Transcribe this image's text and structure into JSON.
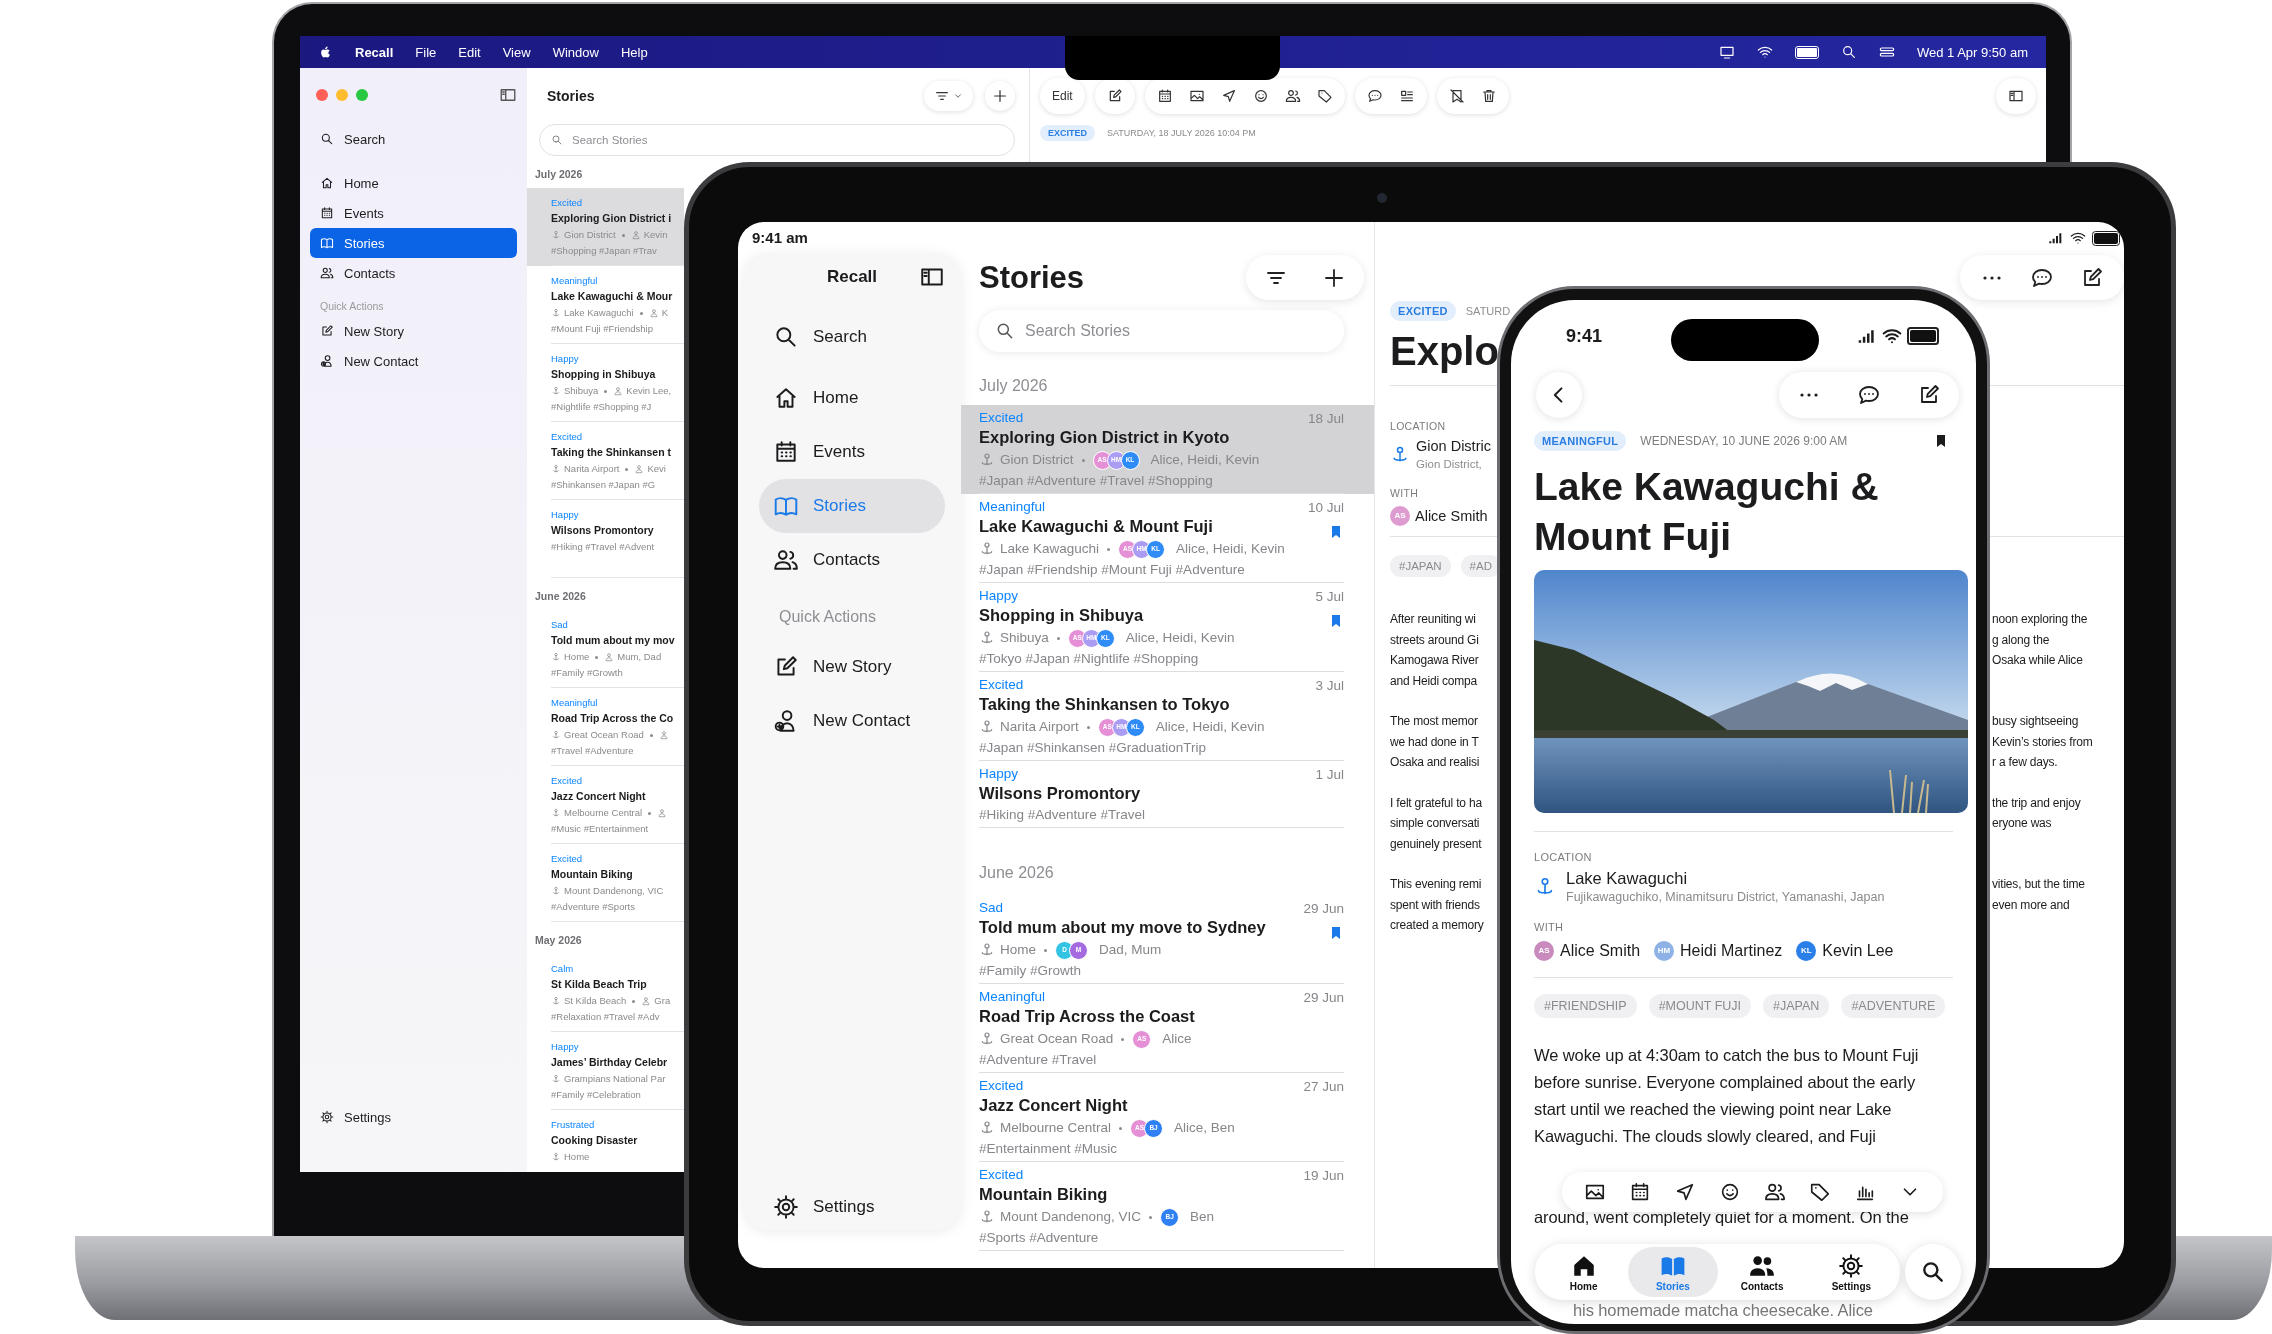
{
  "laptop": {
    "menu_bar": {
      "app": "Recall",
      "menus": [
        "File",
        "Edit",
        "View",
        "Window",
        "Help"
      ],
      "clock": "Wed 1 Apr 9:50 am"
    },
    "sidebar": {
      "search": "Search",
      "items": [
        {
          "label": "Home",
          "selected": false
        },
        {
          "label": "Events",
          "selected": false
        },
        {
          "label": "Stories",
          "selected": true
        },
        {
          "label": "Contacts",
          "selected": false
        }
      ],
      "section": "Quick Actions",
      "actions": [
        "New Story",
        "New Contact"
      ],
      "settings": "Settings"
    },
    "list": {
      "title": "Stories",
      "search_placeholder": "Search Stories",
      "sections": [
        {
          "heading": "July 2026",
          "stories": [
            {
              "mood": "Excited",
              "title": "Exploring Gion District i",
              "place": "Gion District",
              "with_people": true,
              "people": "Kevin",
              "tags": "#Shopping #Japan #Trav",
              "selected": true
            },
            {
              "mood": "Meaningful",
              "title": "Lake Kawaguchi & Mour",
              "place": "Lake Kawaguchi",
              "with_people": true,
              "people": "K",
              "tags": "#Mount Fuji #Friendship",
              "selected": false
            },
            {
              "mood": "Happy",
              "title": "Shopping in Shibuya",
              "place": "Shibuya",
              "with_people": true,
              "people": "Kevin Lee,",
              "tags": "#Nightlife #Shopping #J",
              "selected": false
            },
            {
              "mood": "Excited",
              "title": "Taking the Shinkansen t",
              "place": "Narita Airport",
              "with_people": true,
              "people": "Kevi",
              "tags": "#Shinkansen #Japan #G",
              "selected": false
            },
            {
              "mood": "Happy",
              "title": "Wilsons Promontory",
              "tags": "#Hiking #Travel #Advent",
              "selected": false
            }
          ]
        },
        {
          "heading": "June 2026",
          "stories": [
            {
              "mood": "Sad",
              "title": "Told mum about my mov",
              "place": "Home",
              "with_people": true,
              "people": "Mum, Dad",
              "tags": "#Family #Growth",
              "selected": false
            },
            {
              "mood": "Meaningful",
              "title": "Road Trip Across the Co",
              "place": "Great Ocean Road",
              "with_people": true,
              "tags": "#Travel #Adventure",
              "selected": false
            },
            {
              "mood": "Excited",
              "title": "Jazz Concert Night",
              "place": "Melbourne Central",
              "with_people": true,
              "tags": "#Music #Entertainment",
              "selected": false
            },
            {
              "mood": "Excited",
              "title": "Mountain Biking",
              "place": "Mount Dandenong, VIC",
              "with_people": false,
              "tags": "#Adventure #Sports",
              "selected": false
            }
          ]
        },
        {
          "heading": "May 2026",
          "stories": [
            {
              "mood": "Calm",
              "title": "St Kilda Beach Trip",
              "place": "St Kilda Beach",
              "with_people": true,
              "people": "Gra",
              "tags": "#Relaxation #Travel #Adv",
              "selected": false
            },
            {
              "mood": "Happy",
              "title": "James’ Birthday Celebr",
              "place": "Grampians National Par",
              "with_people": false,
              "tags": "#Family #Celebration",
              "selected": false
            },
            {
              "mood": "Frustrated",
              "title": "Cooking Disaster",
              "place": "Home",
              "with_people": false,
              "selected": false
            }
          ]
        }
      ]
    },
    "detail": {
      "edit": "Edit",
      "mood": "EXCITED",
      "date": "SATURDAY, 18 JULY 2026 10:04 PM"
    }
  },
  "tablet": {
    "status_time": "9:41 am",
    "sidebar": {
      "title": "Recall",
      "search": "Search",
      "items": [
        {
          "label": "Home",
          "selected": false
        },
        {
          "label": "Events",
          "selected": false
        },
        {
          "label": "Stories",
          "selected": true
        },
        {
          "label": "Contacts",
          "selected": false
        }
      ],
      "section": "Quick Actions",
      "actions": [
        "New Story",
        "New Contact"
      ],
      "settings": "Settings"
    },
    "list": {
      "title": "Stories",
      "search_placeholder": "Search Stories",
      "sections": [
        {
          "heading": "July 2026",
          "stories": [
            {
              "mood": "Excited",
              "date": "18 Jul",
              "title": "Exploring Gion District in Kyoto",
              "place": "Gion District",
              "avatars": [
                {
                  "initials": "AS",
                  "color": "#e58fd6"
                },
                {
                  "initials": "HM",
                  "color": "#a99cf2"
                },
                {
                  "initials": "KL",
                  "color": "#2f8cf6"
                }
              ],
              "people": "Alice, Heidi, Kevin",
              "tags": "#Japan #Adventure #Travel #Shopping",
              "bookmarked": false,
              "selected": true
            },
            {
              "mood": "Meaningful",
              "date": "10 Jul",
              "title": "Lake Kawaguchi & Mount Fuji",
              "place": "Lake Kawaguchi",
              "avatars": [
                {
                  "initials": "AS",
                  "color": "#e58fd6"
                },
                {
                  "initials": "HM",
                  "color": "#a99cf2"
                },
                {
                  "initials": "KL",
                  "color": "#2f8cf6"
                }
              ],
              "people": "Alice, Heidi, Kevin",
              "tags": "#Japan #Friendship #Mount Fuji #Adventure",
              "bookmarked": true,
              "selected": false
            },
            {
              "mood": "Happy",
              "date": "5 Jul",
              "title": "Shopping in Shibuya",
              "place": "Shibuya",
              "avatars": [
                {
                  "initials": "AS",
                  "color": "#e58fd6"
                },
                {
                  "initials": "HM",
                  "color": "#a99cf2"
                },
                {
                  "initials": "KL",
                  "color": "#2f8cf6"
                }
              ],
              "people": "Alice, Heidi, Kevin",
              "tags": "#Tokyo #Japan #Nightlife #Shopping",
              "bookmarked": true,
              "selected": false
            },
            {
              "mood": "Excited",
              "date": "3 Jul",
              "title": "Taking the Shinkansen to Tokyo",
              "place": "Narita Airport",
              "avatars": [
                {
                  "initials": "AS",
                  "color": "#e58fd6"
                },
                {
                  "initials": "HM",
                  "color": "#a99cf2"
                },
                {
                  "initials": "KL",
                  "color": "#2f8cf6"
                }
              ],
              "people": "Alice, Heidi, Kevin",
              "tags": "#Japan #Shinkansen #GraduationTrip",
              "bookmarked": false,
              "selected": false
            },
            {
              "mood": "Happy",
              "date": "1 Jul",
              "title": "Wilsons Promontory",
              "tags": "#Hiking #Adventure #Travel",
              "bookmarked": false,
              "selected": false
            }
          ]
        },
        {
          "heading": "June 2026",
          "stories": [
            {
              "mood": "Sad",
              "date": "29 Jun",
              "title": "Told mum about my move to Sydney",
              "place": "Home",
              "avatars": [
                {
                  "initials": "D",
                  "color": "#33c3e3"
                },
                {
                  "initials": "M",
                  "color": "#a46be0"
                }
              ],
              "people": "Dad, Mum",
              "tags": "#Family #Growth",
              "bookmarked": true,
              "selected": false
            },
            {
              "mood": "Meaningful",
              "date": "29 Jun",
              "title": "Road Trip Across the Coast",
              "place": "Great Ocean Road",
              "avatars": [
                {
                  "initials": "AS",
                  "color": "#e58fd6"
                }
              ],
              "people": "Alice",
              "tags": "#Adventure #Travel",
              "bookmarked": false,
              "selected": false
            },
            {
              "mood": "Excited",
              "date": "27 Jun",
              "title": "Jazz Concert Night",
              "place": "Melbourne Central",
              "avatars": [
                {
                  "initials": "AS",
                  "color": "#e58fd6"
                },
                {
                  "initials": "BJ",
                  "color": "#2f7ff5"
                }
              ],
              "people": "Alice, Ben",
              "tags": "#Entertainment #Music",
              "bookmarked": false,
              "selected": false
            },
            {
              "mood": "Excited",
              "date": "19 Jun",
              "title": "Mountain Biking",
              "place": "Mount Dandenong, VIC",
              "avatars": [
                {
                  "initials": "BJ",
                  "color": "#2f7ff5"
                }
              ],
              "people": "Ben",
              "tags": "#Sports #Adventure",
              "bookmarked": false,
              "selected": false
            }
          ]
        }
      ]
    },
    "detail": {
      "mood": "EXCITED",
      "date": "SATURD",
      "title": "Explo",
      "location_label": "LOCATION",
      "place": "Gion Distric",
      "address": "Gion District,",
      "with_label": "WITH",
      "people": [
        {
          "initials": "AS",
          "name": "Alice Smith",
          "color": "#de9bcf"
        }
      ],
      "tags": [
        "#JAPAN",
        "#AD"
      ],
      "paragraphs": [
        {
          "left": [
            "After reuniting wi",
            "streets around Gi",
            "Kamogawa River",
            "and Heidi compa"
          ],
          "right": [
            "noon exploring the",
            "g along the",
            "Osaka while Alice"
          ]
        },
        {
          "left": [
            "The most memor",
            "we had done in T",
            "Osaka and realisi"
          ],
          "right": [
            "busy sightseeing",
            "Kevin’s stories from",
            "r a few days."
          ]
        },
        {
          "left": [
            "I felt grateful to ha",
            "simple conversati",
            "genuinely present"
          ],
          "right": [
            "the trip and enjoy",
            "eryone was"
          ]
        },
        {
          "left": [
            "This evening remi",
            "spent with friends",
            "created a memory"
          ],
          "right": [
            "vities, but the time",
            "even more and"
          ]
        }
      ]
    }
  },
  "phone": {
    "status_time": "9:41",
    "mood": "MEANINGFUL",
    "date": "WEDNESDAY, 10 JUNE 2026 9:00 AM",
    "bookmarked": true,
    "title": "Lake Kawaguchi & Mount Fuji",
    "location_label": "LOCATION",
    "place": "Lake Kawaguchi",
    "address": "Fujikawaguchiko, Minamitsuru District, Yamanashi, Japan",
    "with_label": "WITH",
    "people": [
      {
        "initials": "AS",
        "name": "Alice Smith",
        "color": "#c98bbd"
      },
      {
        "initials": "HM",
        "name": "Heidi Martinez",
        "color": "#8fb2e6"
      },
      {
        "initials": "KL",
        "name": "Kevin Lee",
        "color": "#2a7fe8"
      }
    ],
    "tags": [
      "#FRIENDSHIP",
      "#MOUNT FUJI",
      "#JAPAN",
      "#ADVENTURE"
    ],
    "body_lines": [
      "We woke up at 4:30am to catch the bus to Mount Fuji",
      "before sunrise. Everyone complained about the early",
      "start until we reached the viewing point near Lake",
      "Kawaguchi. The clouds slowly cleared, and Fuji"
    ],
    "body_fragments": [
      "around, went completely quiet for a moment. On the",
      "his homemade matcha cheesecake. Alice"
    ],
    "tabs": [
      {
        "label": "Home",
        "selected": false
      },
      {
        "label": "Stories",
        "selected": true
      },
      {
        "label": "Contacts",
        "selected": false
      },
      {
        "label": "Settings",
        "selected": false
      }
    ]
  }
}
